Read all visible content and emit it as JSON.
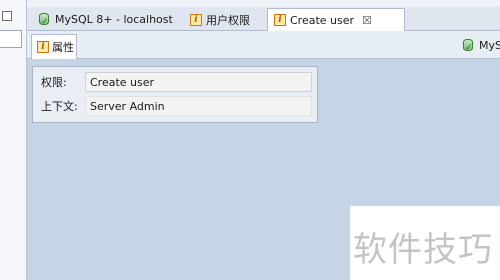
{
  "tabs": [
    {
      "label": "MySQL 8+ - localhost",
      "icon": "database-connection-icon"
    },
    {
      "label": "用户权限",
      "icon": "info-icon"
    },
    {
      "label": "Create user",
      "icon": "info-icon",
      "close": "☒"
    }
  ],
  "subtabs": {
    "properties_label": "属性",
    "right_label": "MyS"
  },
  "properties": {
    "privilege_label": "权限:",
    "privilege_value": "Create user",
    "context_label": "上下文:",
    "context_value": "Server Admin"
  },
  "watermark": "软件技巧"
}
